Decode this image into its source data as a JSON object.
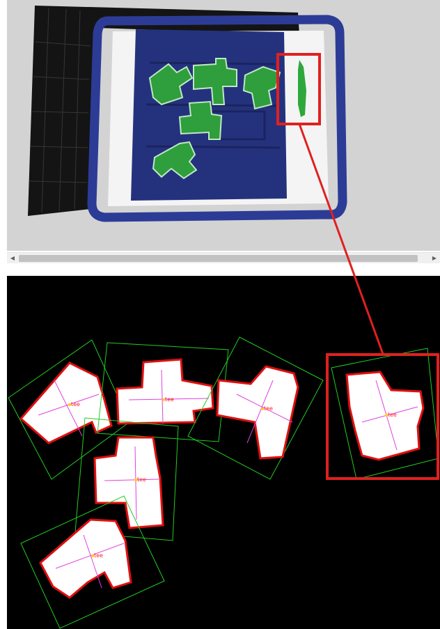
{
  "viewer": {
    "scrollbar": {
      "left_arrow": "◀",
      "right_arrow": "▶"
    }
  },
  "detection": {
    "objects": [
      {
        "label": "tee"
      },
      {
        "label": "tee"
      },
      {
        "label": "tee"
      },
      {
        "label": "tee"
      },
      {
        "label": "tee"
      },
      {
        "label": "tee"
      }
    ]
  },
  "colors": {
    "viewer_bg": "#d3d3d3",
    "tray_blue": "#28358a",
    "piece_green": "#2f9e3c",
    "highlight_red": "#e02020",
    "bbox_green": "#22cc22",
    "axis_magenta": "#e040e0",
    "contour_red": "#e01010",
    "center_yellow": "#ffd000"
  }
}
